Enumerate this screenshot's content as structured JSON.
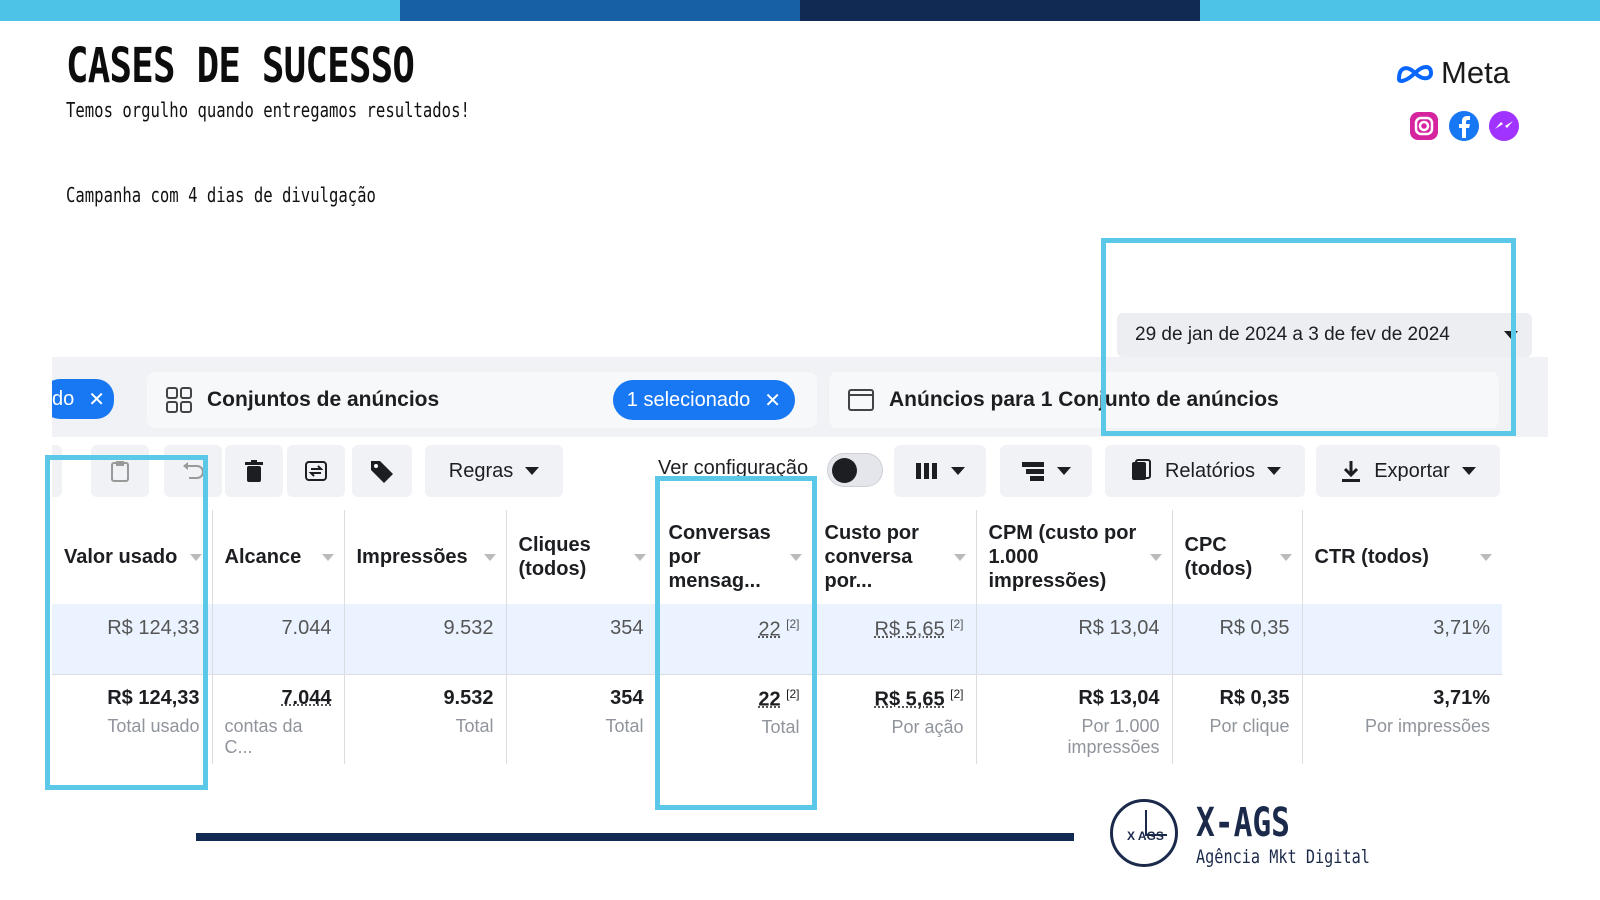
{
  "colors": {
    "topbar": [
      "#4ec3e8",
      "#1760a6",
      "#102a54",
      "#4ec3e8"
    ],
    "highlight": "#5ac8e6",
    "accent": "#1877f2",
    "navy": "#102a54"
  },
  "header": {
    "title": "CASES DE SUCESSO",
    "subtitle": "Temos orgulho quando entregamos resultados!",
    "campaign": "Campanha com 4 dias de divulgação"
  },
  "meta": {
    "label": "Meta",
    "icons": [
      "instagram-icon",
      "facebook-icon",
      "messenger-icon"
    ]
  },
  "date_range": {
    "label": "29 de jan de 2024 a 3 de fev de 2024"
  },
  "tabs": {
    "campaign_partial": "do",
    "ad_sets": "Conjuntos de anúncios",
    "selected_pill": "1 selecionado",
    "ads": "Anúncios para 1 Conjunto de anúncios"
  },
  "toolbar": {
    "rules": "Regras",
    "view_config": "Ver configuração",
    "reports": "Relatórios",
    "export": "Exportar"
  },
  "table": {
    "columns": [
      "Valor usado",
      "Alcance",
      "Impressões",
      "Cliques (todos)",
      "Conversas por mensag...",
      "Custo por conversa por...",
      "CPM (custo por 1.000 impressões)",
      "CPC (todos)",
      "CTR (todos)"
    ],
    "row": [
      "R$ 124,33",
      "7.044",
      "9.532",
      "354",
      "22",
      "R$ 5,65",
      "R$ 13,04",
      "R$ 0,35",
      "3,71%"
    ],
    "totals": [
      "R$ 124,33",
      "7.044",
      "9.532",
      "354",
      "22",
      "R$ 5,65",
      "R$ 13,04",
      "R$ 0,35",
      "3,71%"
    ],
    "totals_sub": [
      "Total usado",
      "contas da C...",
      "Total",
      "Total",
      "Total",
      "Por ação",
      "Por 1.000 impressões",
      "Por clique",
      "Por impressões"
    ],
    "footnote": "[2]"
  },
  "brand": {
    "name": "X-AGS",
    "tagline": "Agência Mkt Digital",
    "logo_small": "X AGS"
  }
}
